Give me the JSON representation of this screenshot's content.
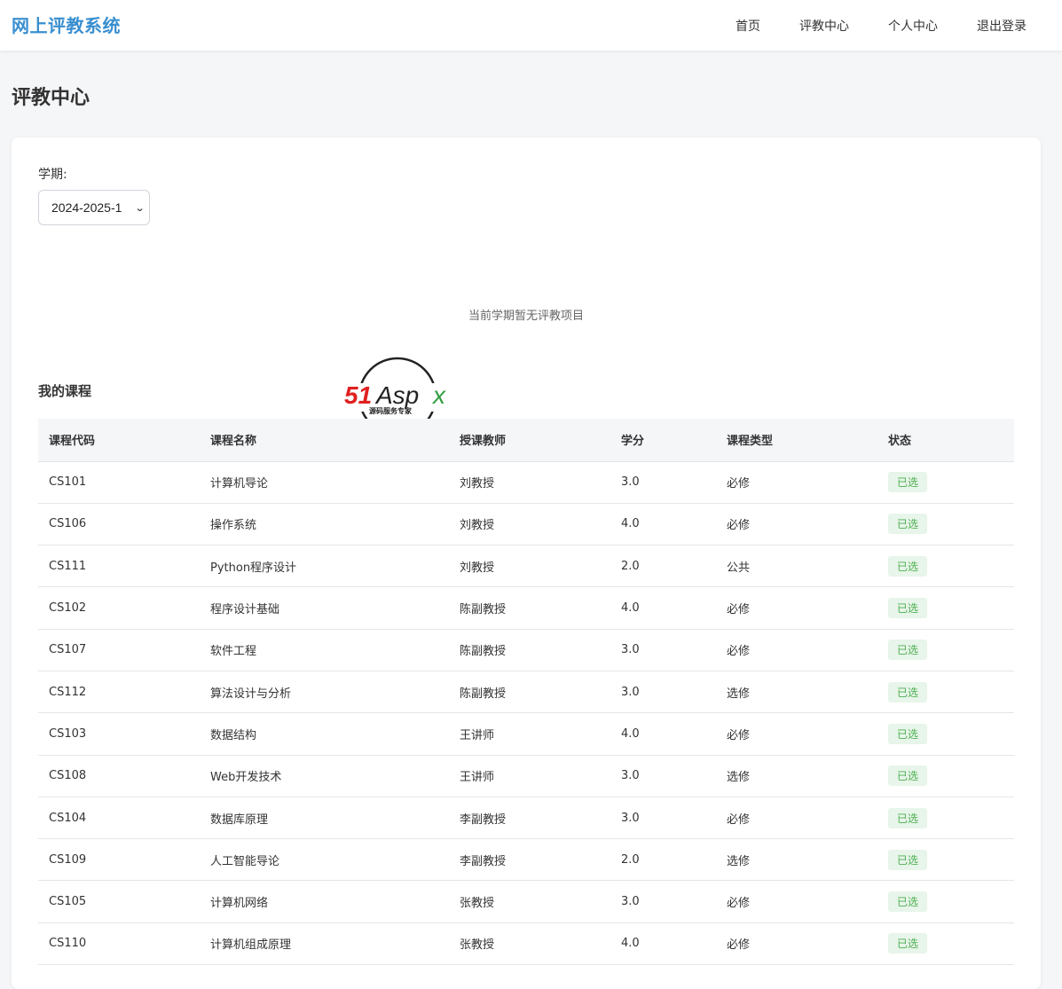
{
  "app": {
    "brand": "网上评教系统"
  },
  "nav": {
    "items": [
      {
        "label": "首页"
      },
      {
        "label": "评教中心"
      },
      {
        "label": "个人中心"
      },
      {
        "label": "退出登录"
      }
    ]
  },
  "page": {
    "title": "评教中心"
  },
  "semester": {
    "label": "学期:",
    "selected": "2024-2025-1"
  },
  "empty_message": "当前学期暂无评教项目",
  "watermark": {
    "text": "51Aspx",
    "subtext": "源码服务专家",
    "colors": {
      "red": "#e02020",
      "green": "#2e9e3e",
      "dark": "#222222"
    }
  },
  "courses": {
    "title": "我的课程",
    "headers": [
      "课程代码",
      "课程名称",
      "授课教师",
      "学分",
      "课程类型",
      "状态"
    ],
    "rows": [
      {
        "code": "CS101",
        "name": "计算机导论",
        "teacher": "刘教授",
        "credit": "3.0",
        "type": "必修",
        "status": "已选"
      },
      {
        "code": "CS106",
        "name": "操作系统",
        "teacher": "刘教授",
        "credit": "4.0",
        "type": "必修",
        "status": "已选"
      },
      {
        "code": "CS111",
        "name": "Python程序设计",
        "teacher": "刘教授",
        "credit": "2.0",
        "type": "公共",
        "status": "已选"
      },
      {
        "code": "CS102",
        "name": "程序设计基础",
        "teacher": "陈副教授",
        "credit": "4.0",
        "type": "必修",
        "status": "已选"
      },
      {
        "code": "CS107",
        "name": "软件工程",
        "teacher": "陈副教授",
        "credit": "3.0",
        "type": "必修",
        "status": "已选"
      },
      {
        "code": "CS112",
        "name": "算法设计与分析",
        "teacher": "陈副教授",
        "credit": "3.0",
        "type": "选修",
        "status": "已选"
      },
      {
        "code": "CS103",
        "name": "数据结构",
        "teacher": "王讲师",
        "credit": "4.0",
        "type": "必修",
        "status": "已选"
      },
      {
        "code": "CS108",
        "name": "Web开发技术",
        "teacher": "王讲师",
        "credit": "3.0",
        "type": "选修",
        "status": "已选"
      },
      {
        "code": "CS104",
        "name": "数据库原理",
        "teacher": "李副教授",
        "credit": "3.0",
        "type": "必修",
        "status": "已选"
      },
      {
        "code": "CS109",
        "name": "人工智能导论",
        "teacher": "李副教授",
        "credit": "2.0",
        "type": "选修",
        "status": "已选"
      },
      {
        "code": "CS105",
        "name": "计算机网络",
        "teacher": "张教授",
        "credit": "3.0",
        "type": "必修",
        "status": "已选"
      },
      {
        "code": "CS110",
        "name": "计算机组成原理",
        "teacher": "张教授",
        "credit": "4.0",
        "type": "必修",
        "status": "已选"
      }
    ]
  },
  "colors": {
    "brand": "#3a8fd0",
    "badge_bg": "#e8f5ea",
    "badge_text": "#4caf50"
  }
}
